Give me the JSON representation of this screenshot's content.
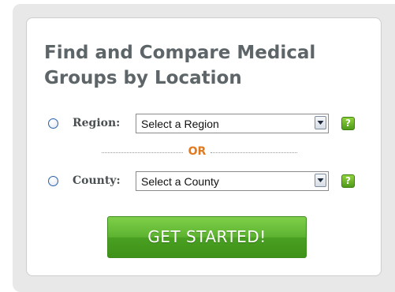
{
  "title": "Find and Compare Medical Groups by Location",
  "region": {
    "label": "Region:",
    "select_value": "Select a Region",
    "help": "?"
  },
  "divider": {
    "text": "OR"
  },
  "county": {
    "label": "County:",
    "select_value": "Select a County",
    "help": "?"
  },
  "cta": {
    "label": "GET STARTED!"
  },
  "colors": {
    "title": "#5d6568",
    "or_accent": "#e07a1f",
    "cta_green": "#5cb330",
    "help_green": "#6db82a",
    "radio_border": "#2a62a8"
  },
  "icons": {
    "radio": "radio-button-icon",
    "dropdown": "chevron-down-icon",
    "help": "help-icon"
  }
}
